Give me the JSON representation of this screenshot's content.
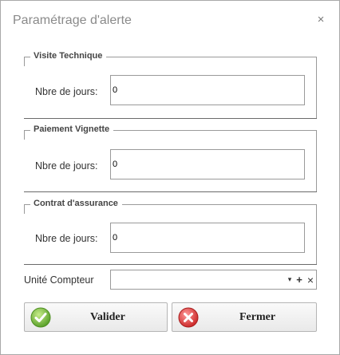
{
  "dialog": {
    "title": "Paramétrage d'alerte",
    "close_glyph": "×",
    "close_icon": "close-icon"
  },
  "sections": [
    {
      "legend": "Visite Technique",
      "label": "Nbre de jours:",
      "value": "0"
    },
    {
      "legend": "Paiement Vignette",
      "label": "Nbre de jours:",
      "value": "0"
    },
    {
      "legend": "Contrat d'assurance",
      "label": "Nbre de jours:",
      "value": "0"
    }
  ],
  "unite": {
    "label": "Unité Compteur",
    "value": "",
    "dropdown_glyph": "▾",
    "add_glyph": "+",
    "clear_glyph": "×"
  },
  "buttons": {
    "valider": {
      "label": "Valider",
      "icon": "check-icon",
      "color": "#7cc242"
    },
    "fermer": {
      "label": "Fermer",
      "icon": "cancel-icon",
      "color": "#e04b4b"
    }
  }
}
